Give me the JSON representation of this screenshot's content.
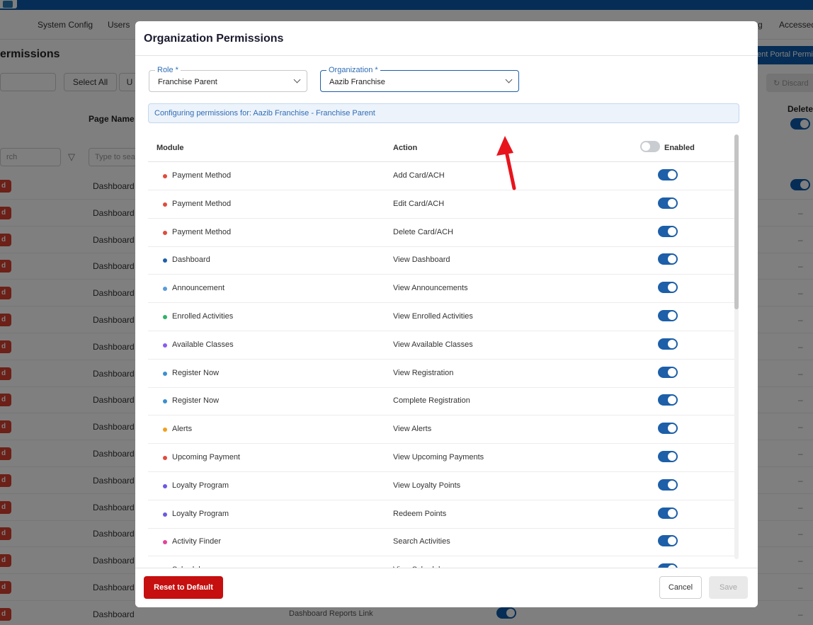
{
  "background": {
    "nav": [
      "System Config",
      "Users",
      "g",
      "Accessed"
    ],
    "page_title": "ermissions",
    "select_all": "Select All",
    "other_button": "U",
    "portal_button": "ent Portal Permi",
    "discard": "Discard",
    "col_page_name": "Page Name",
    "col_delete": "Delete",
    "search_placeholder": "rch",
    "type_search_placeholder": "Type to sea",
    "row_badge": "d",
    "row_page": "Dashboard",
    "dash": "–",
    "last_row_text": "Dashboard Reports Link",
    "row_count": 17
  },
  "modal": {
    "title": "Organization Permissions",
    "role": {
      "label": "Role *",
      "value": "Franchise Parent"
    },
    "organization": {
      "label": "Organization *",
      "value": "Aazib Franchise"
    },
    "info": "Configuring permissions for: Aazib Franchise - Franchise Parent",
    "columns": {
      "module": "Module",
      "action": "Action",
      "enabled": "Enabled"
    },
    "header_toggle": "off",
    "rows": [
      {
        "module": "Payment Method",
        "action": "Add Card/ACH",
        "color": "#e04b3c",
        "enabled": true
      },
      {
        "module": "Payment Method",
        "action": "Edit Card/ACH",
        "color": "#e04b3c",
        "enabled": true
      },
      {
        "module": "Payment Method",
        "action": "Delete Card/ACH",
        "color": "#e04b3c",
        "enabled": true
      },
      {
        "module": "Dashboard",
        "action": "View Dashboard",
        "color": "#1f5fa8",
        "enabled": true
      },
      {
        "module": "Announcement",
        "action": "View Announcements",
        "color": "#5a9bd8",
        "enabled": true
      },
      {
        "module": "Enrolled Activities",
        "action": "View Enrolled Activities",
        "color": "#2fb36b",
        "enabled": true
      },
      {
        "module": "Available Classes",
        "action": "View Available Classes",
        "color": "#8a5cf0",
        "enabled": true
      },
      {
        "module": "Register Now",
        "action": "View Registration",
        "color": "#3a8fd0",
        "enabled": true
      },
      {
        "module": "Register Now",
        "action": "Complete Registration",
        "color": "#3a8fd0",
        "enabled": true
      },
      {
        "module": "Alerts",
        "action": "View Alerts",
        "color": "#f0a020",
        "enabled": true
      },
      {
        "module": "Upcoming Payment",
        "action": "View Upcoming Payments",
        "color": "#e04b3c",
        "enabled": true
      },
      {
        "module": "Loyalty Program",
        "action": "View Loyalty Points",
        "color": "#6a5ae0",
        "enabled": true
      },
      {
        "module": "Loyalty Program",
        "action": "Redeem Points",
        "color": "#6a5ae0",
        "enabled": true
      },
      {
        "module": "Activity Finder",
        "action": "Search Activities",
        "color": "#e0459a",
        "enabled": true
      },
      {
        "module": "Schedule",
        "action": "View Schedule",
        "color": "#3a8fd0",
        "enabled": true
      }
    ],
    "buttons": {
      "reset": "Reset to Default",
      "cancel": "Cancel",
      "save": "Save"
    }
  }
}
